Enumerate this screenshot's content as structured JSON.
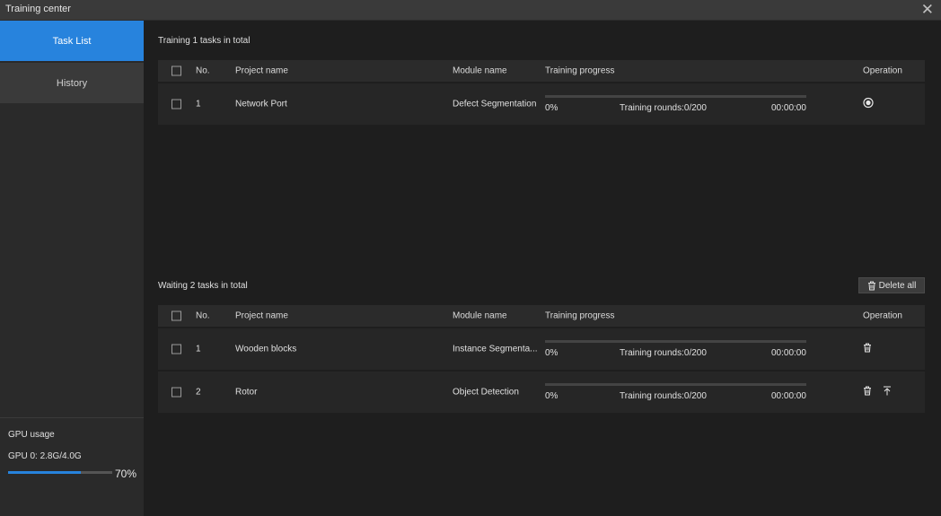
{
  "window": {
    "title": "Training center",
    "close_glyph": "✕"
  },
  "sidebar": {
    "items": [
      {
        "label": "Task List",
        "active": true
      },
      {
        "label": "History",
        "active": false
      }
    ],
    "gpu": {
      "label": "GPU usage",
      "device": "GPU 0: 2.8G/4.0G",
      "percent_text": "70%",
      "fraction": 0.7
    }
  },
  "training": {
    "title": "Training  1 tasks in total",
    "headers": {
      "no": "No.",
      "project": "Project name",
      "module": "Module name",
      "progress": "Training progress",
      "operation": "Operation"
    },
    "rows": [
      {
        "no": "1",
        "project": "Network Port",
        "module": "Defect Segmentation",
        "percent": "0%",
        "rounds": "Training rounds:0/200",
        "time": "00:00:00",
        "progress_fraction": 0,
        "op_icons": [
          "stop-icon"
        ]
      }
    ]
  },
  "waiting": {
    "title": "Waiting  2 tasks in total",
    "delete_all_label": "Delete all",
    "headers": {
      "no": "No.",
      "project": "Project name",
      "module": "Module name",
      "progress": "Training progress",
      "operation": "Operation"
    },
    "rows": [
      {
        "no": "1",
        "project": "Wooden blocks",
        "module": "Instance Segmenta...",
        "percent": "0%",
        "rounds": "Training rounds:0/200",
        "time": "00:00:00",
        "progress_fraction": 0,
        "op_icons": [
          "trash-icon"
        ]
      },
      {
        "no": "2",
        "project": "Rotor",
        "module": "Object Detection",
        "percent": "0%",
        "rounds": "Training rounds:0/200",
        "time": "00:00:00",
        "progress_fraction": 0,
        "op_icons": [
          "trash-icon",
          "move-to-top-icon"
        ]
      }
    ]
  },
  "colors": {
    "accent": "#2783dd",
    "background": "#1e1e1e",
    "sidebar": "#2a2a2a"
  }
}
